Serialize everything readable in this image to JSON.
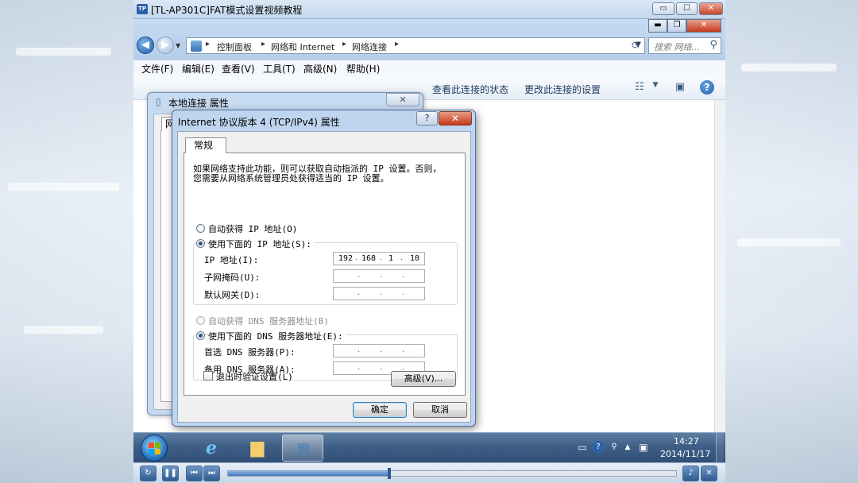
{
  "player": {
    "title": "[TL-AP301C]FAT模式设置视频教程",
    "progress_percent": 36
  },
  "explorer": {
    "breadcrumbs": [
      "控制面板",
      "网络和 Internet",
      "网络连接"
    ],
    "search_placeholder": "搜索 网络...",
    "menu": [
      "文件(F)",
      "编辑(E)",
      "查看(V)",
      "工具(T)",
      "高级(N)",
      "帮助(H)"
    ],
    "commands": [
      "查看此连接的状态",
      "更改此连接的设置"
    ]
  },
  "lan_dialog": {
    "title": "本地连接 属性",
    "tab": "网络",
    "close_glyph": "✕"
  },
  "ipv4_dialog": {
    "title": "Internet 协议版本 4 (TCP/IPv4) 属性",
    "help_glyph": "?",
    "close_glyph": "✕",
    "tab_general": "常规",
    "description_line1": "如果网络支持此功能，则可以获取自动指派的 IP 设置。否则，",
    "description_line2": "您需要从网络系统管理员处获得适当的 IP 设置。",
    "auto_ip_label": "自动获得 IP 地址(O)",
    "manual_ip_label": "使用下面的 IP 地址(S):",
    "ip_label": "IP 地址(I):",
    "ip_value": [
      "192",
      "168",
      "1",
      "10"
    ],
    "subnet_label": "子网掩码(U):",
    "gateway_label": "默认网关(D):",
    "auto_dns_label": "自动获得 DNS 服务器地址(B)",
    "manual_dns_label": "使用下面的 DNS 服务器地址(E):",
    "preferred_dns_label": "首选 DNS 服务器(P):",
    "alternate_dns_label": "备用 DNS 服务器(A):",
    "validate_label": "退出时验证设置(L)",
    "advanced_button": "高级(V)...",
    "ok_button": "确定",
    "cancel_button": "取消",
    "manual_ip_selected": true,
    "manual_dns_selected": true,
    "validate_checked": false
  },
  "taskbar": {
    "time": "14:27",
    "date": "2014/11/17"
  },
  "colors": {
    "taskbar": "#3f5f86",
    "dialog_frame": "#bfd5ef",
    "close_button": "#c2391b"
  }
}
